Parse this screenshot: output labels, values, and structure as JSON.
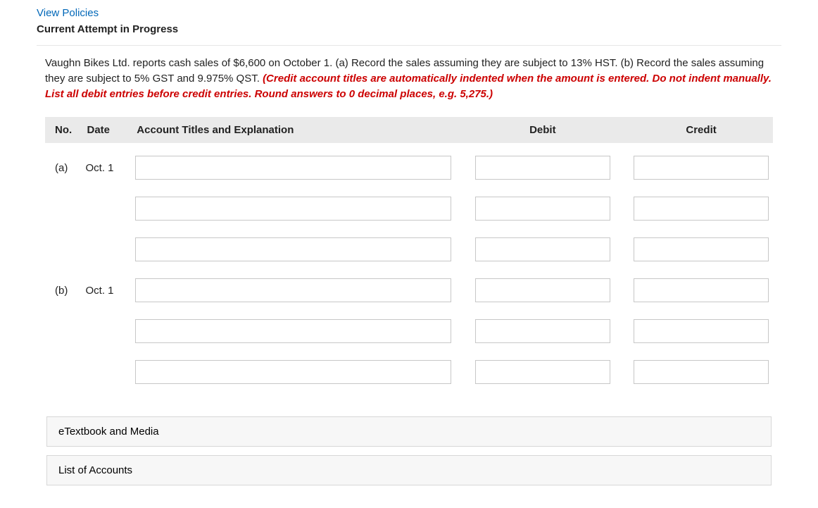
{
  "links": {
    "view_policies": "View Policies"
  },
  "status_label": "Current Attempt in Progress",
  "question": {
    "main": "Vaughn Bikes Ltd. reports cash sales of $6,600 on October 1. (a) Record the sales assuming they are subject to 13% HST. (b) Record the sales assuming they are subject to 5% GST and 9.975% QST. ",
    "instruction": "(Credit account titles are automatically indented when the amount is entered. Do not indent manually. List all debit entries before credit entries. Round answers to 0 decimal places, e.g. 5,275.)"
  },
  "table": {
    "headers": {
      "no": "No.",
      "date": "Date",
      "acct": "Account Titles and Explanation",
      "debit": "Debit",
      "credit": "Credit"
    },
    "rows": [
      {
        "no": "(a)",
        "date": "Oct. 1",
        "acct": "",
        "debit": "",
        "credit": ""
      },
      {
        "no": "",
        "date": "",
        "acct": "",
        "debit": "",
        "credit": ""
      },
      {
        "no": "",
        "date": "",
        "acct": "",
        "debit": "",
        "credit": ""
      },
      {
        "no": "(b)",
        "date": "Oct. 1",
        "acct": "",
        "debit": "",
        "credit": ""
      },
      {
        "no": "",
        "date": "",
        "acct": "",
        "debit": "",
        "credit": ""
      },
      {
        "no": "",
        "date": "",
        "acct": "",
        "debit": "",
        "credit": ""
      }
    ]
  },
  "panels": {
    "etextbook": "eTextbook and Media",
    "accounts": "List of Accounts"
  }
}
